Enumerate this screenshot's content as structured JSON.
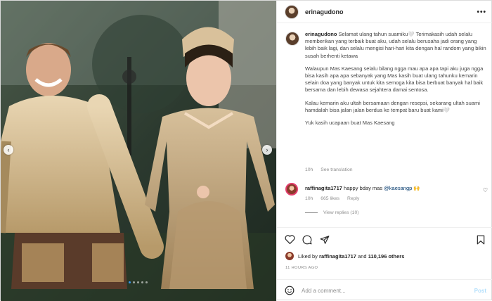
{
  "post": {
    "username": "erinagudono",
    "more_icon": "more-dots-icon"
  },
  "caption": {
    "username": "erinagudono",
    "paragraphs": [
      "Selamat ulang tahun suamiku🤍 Terimakasih udah selalu memberikan yang terbaik buat aku, udah selalu berusaha jadi orang yang lebih baik lagi, dan selalu mengisi hari-hari kita dengan hal random yang bikin susah berhenti ketawa",
      "Walaupun Mas Kaesang selalu bilang ngga mau apa apa tapi aku juga ngga bisa kasih apa apa sebanyak yang Mas kasih buat ulang tahunku kemarin selain doa yang banyak untuk kita semoga kita bisa berbuat banyak hal baik bersama dan lebih dewasa sejahtera damai sentosa.",
      "Kalau kemarin aku ultah bersamaan dengan resepsi, sekarang ultah suami hamdalah bisa jalan jalan berdua ke tempat baru buat kami🤍",
      "Yuk kasih ucapaan buat Mas Kaesang"
    ],
    "time": "10h",
    "see_translation": "See translation"
  },
  "comment": {
    "username": "raffinagita1717",
    "text_before": "happy bday mas ",
    "mention": "@kaesangp",
    "emoji": "🙌",
    "time": "10h",
    "likes": "665 likes",
    "reply": "Reply",
    "view_replies": "View replies (10)"
  },
  "likes": {
    "prefix": "Liked by ",
    "user": "raffinagita1717",
    "middle": " and ",
    "count": "110,196 others"
  },
  "timestamp": "11 HOURS AGO",
  "add_comment": {
    "placeholder": "Add a comment...",
    "post_label": "Post"
  },
  "carousel": {
    "dots": 5,
    "active_index": 0
  },
  "colors": {
    "link_blue": "#00376b",
    "post_disabled": "#b2dffc",
    "active_dot": "#3897f0",
    "story_ring": "#e33d6c"
  }
}
